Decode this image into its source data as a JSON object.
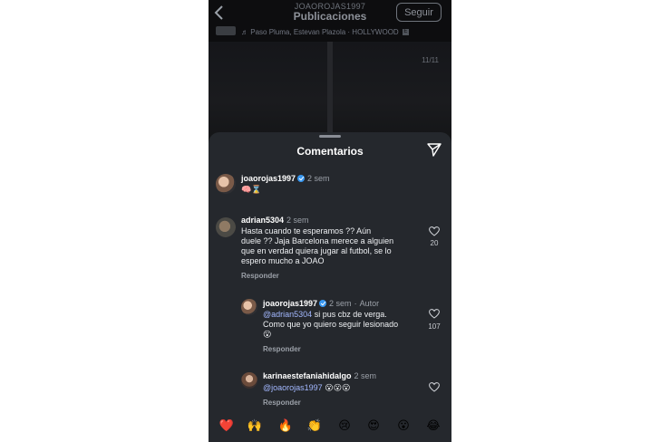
{
  "header": {
    "username": "JOAOROJAS1997",
    "title": "Publicaciones",
    "follow_label": "Seguir"
  },
  "music": {
    "text": "Paso Pluma, Estevan Plazola · HOLLYWOOD",
    "explicit": "E"
  },
  "post": {
    "page_counter": "11/11"
  },
  "sheet": {
    "title": "Comentarios"
  },
  "comments": [
    {
      "username": "joaorojas1997",
      "time": "2 sem",
      "text": "🧠⌛"
    },
    {
      "username": "adrian5304",
      "time": "2 sem",
      "lines": [
        "Hasta cuando te esperamos ?? Aún",
        "duele ?? Jaja Barcelona merece a alguien",
        "que en verdad quiera jugar al futbol, se lo",
        "espero mucho a JOAO"
      ],
      "reply_label": "Responder",
      "likes": "20"
    },
    {
      "username": "joaorojas1997",
      "time": "2 sem",
      "author_tag": "Autor",
      "mention": "@adrian5304",
      "line1_rest": " si pus cbz de verga.",
      "line2": "Como que yo quiero seguir lesionado",
      "line3": "😮",
      "reply_label": "Responder",
      "likes": "107"
    },
    {
      "username": "karinaestefaniahidalgo",
      "time": "2 sem",
      "mention": "@joaorojas1997",
      "rest": " 😮😮😮",
      "reply_label": "Responder"
    }
  ],
  "reactions": [
    "❤️",
    "🙌",
    "🔥",
    "👏",
    "😢",
    "😍",
    "😮",
    "😂"
  ],
  "colors": {
    "sheet_bg": "#25282d",
    "mention": "#a3b8ff",
    "verified": "#3897f0"
  }
}
